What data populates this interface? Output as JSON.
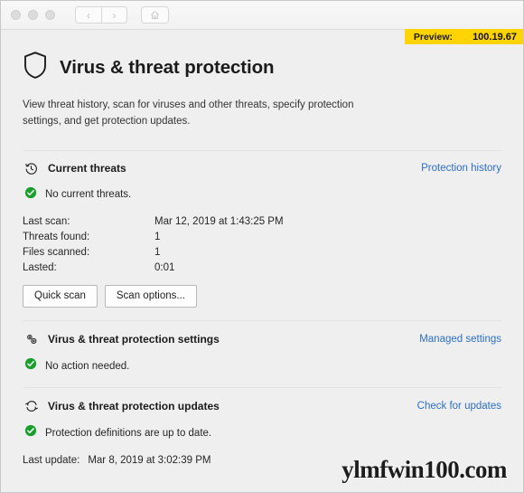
{
  "titlebar": {
    "traffic_lights": [
      "close",
      "minimize",
      "zoom"
    ],
    "back_glyph": "‹",
    "forward_glyph": "›",
    "home_icon": "home-icon"
  },
  "preview": {
    "label": "Preview:",
    "value": "100.19.67",
    "background": "#ffd400"
  },
  "page": {
    "icon": "shield-icon",
    "title": "Virus & threat protection",
    "description": "View threat history, scan for viruses and other threats, specify protection settings, and get protection updates."
  },
  "sections": [
    {
      "icon": "history-clock-icon",
      "title": "Current threats",
      "link": "Protection history",
      "status": "No current threats.",
      "details": [
        {
          "label": "Last scan:",
          "value": "Mar 12, 2019 at 1:43:25 PM"
        },
        {
          "label": "Threats found:",
          "value": "1"
        },
        {
          "label": "Files scanned:",
          "value": "1"
        },
        {
          "label": "Lasted:",
          "value": "0:01"
        }
      ],
      "buttons": [
        {
          "label": "Quick scan"
        },
        {
          "label": "Scan options..."
        }
      ]
    },
    {
      "icon": "settings-gears-icon",
      "title": "Virus & threat protection settings",
      "link": "Managed settings",
      "status": "No action needed."
    },
    {
      "icon": "refresh-sync-icon",
      "title": "Virus & threat protection updates",
      "link": "Check for updates",
      "status": "Protection definitions are up to date.",
      "last_update_label": "Last update:",
      "last_update_value": "Mar 8, 2019 at 3:02:39 PM"
    }
  ],
  "watermark": "ylmfwin100.com",
  "colors": {
    "link": "#2d6fc4",
    "ok_green": "#1a9e2c",
    "background": "#efefef",
    "accent_yellow": "#ffd400"
  }
}
